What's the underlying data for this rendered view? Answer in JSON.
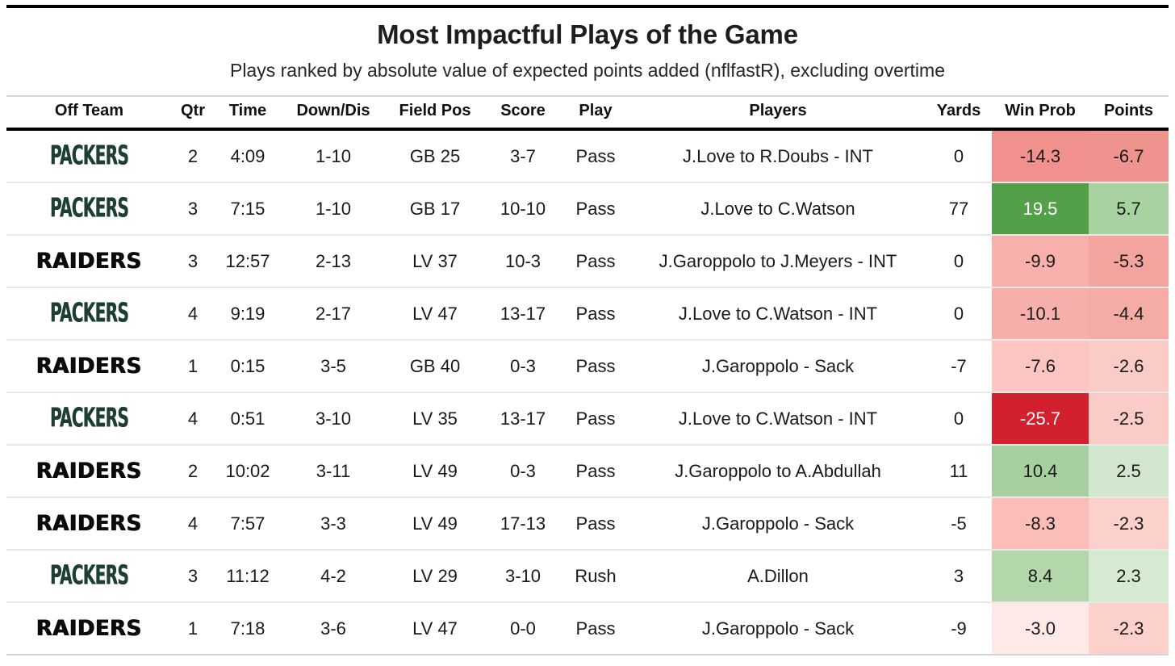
{
  "header": {
    "title": "Most Impactful Plays of the Game",
    "subtitle": "Plays ranked by absolute value of expected points added (nflfastR), excluding overtime"
  },
  "table": {
    "columns": [
      {
        "key": "team",
        "label": "Off Team"
      },
      {
        "key": "qtr",
        "label": "Qtr"
      },
      {
        "key": "time",
        "label": "Time"
      },
      {
        "key": "down",
        "label": "Down/Dis"
      },
      {
        "key": "field",
        "label": "Field Pos"
      },
      {
        "key": "score",
        "label": "Score"
      },
      {
        "key": "play",
        "label": "Play"
      },
      {
        "key": "players",
        "label": "Players"
      },
      {
        "key": "yards",
        "label": "Yards"
      },
      {
        "key": "winprob",
        "label": "Win Prob"
      },
      {
        "key": "points",
        "label": "Points"
      }
    ],
    "rows": [
      {
        "team": "PACKERS",
        "team_class": "packers",
        "qtr": "2",
        "time": "4:09",
        "down": "1-10",
        "field": "GB 25",
        "score": "3-7",
        "play": "Pass",
        "players": "J.Love to R.Doubs - INT",
        "yards": "0",
        "winprob": "-14.3",
        "winprob_bg": "#f0918d",
        "winprob_fg": "#1a1a1a",
        "points": "-6.7",
        "points_bg": "#ef938f",
        "points_fg": "#1a1a1a"
      },
      {
        "team": "PACKERS",
        "team_class": "packers",
        "qtr": "3",
        "time": "7:15",
        "down": "1-10",
        "field": "GB 17",
        "score": "10-10",
        "play": "Pass",
        "players": "J.Love to C.Watson",
        "yards": "77",
        "winprob": "19.5",
        "winprob_bg": "#54a04a",
        "winprob_fg": "#ffffff",
        "points": "5.7",
        "points_bg": "#a8d2a0",
        "points_fg": "#1a1a1a"
      },
      {
        "team": "RAIDERS",
        "team_class": "raiders",
        "qtr": "3",
        "time": "12:57",
        "down": "2-13",
        "field": "LV 37",
        "score": "10-3",
        "play": "Pass",
        "players": "J.Garoppolo to J.Meyers - INT",
        "yards": "0",
        "winprob": "-9.9",
        "winprob_bg": "#f7b0ac",
        "winprob_fg": "#1a1a1a",
        "points": "-5.3",
        "points_bg": "#f3a49f",
        "points_fg": "#1a1a1a"
      },
      {
        "team": "PACKERS",
        "team_class": "packers",
        "qtr": "4",
        "time": "9:19",
        "down": "2-17",
        "field": "LV 47",
        "score": "13-17",
        "play": "Pass",
        "players": "J.Love to C.Watson - INT",
        "yards": "0",
        "winprob": "-10.1",
        "winprob_bg": "#f7afab",
        "winprob_fg": "#1a1a1a",
        "points": "-4.4",
        "points_bg": "#f5aba6",
        "points_fg": "#1a1a1a"
      },
      {
        "team": "RAIDERS",
        "team_class": "raiders",
        "qtr": "1",
        "time": "0:15",
        "down": "3-5",
        "field": "GB 40",
        "score": "0-3",
        "play": "Pass",
        "players": "J.Garoppolo - Sack",
        "yards": "-7",
        "winprob": "-7.6",
        "winprob_bg": "#fbc6c2",
        "winprob_fg": "#1a1a1a",
        "points": "-2.6",
        "points_bg": "#fbcbc6",
        "points_fg": "#1a1a1a"
      },
      {
        "team": "PACKERS",
        "team_class": "packers",
        "qtr": "4",
        "time": "0:51",
        "down": "3-10",
        "field": "LV 35",
        "score": "13-17",
        "play": "Pass",
        "players": "J.Love to C.Watson - INT",
        "yards": "0",
        "winprob": "-25.7",
        "winprob_bg": "#d2202f",
        "winprob_fg": "#ffffff",
        "points": "-2.5",
        "points_bg": "#fbccc7",
        "points_fg": "#1a1a1a"
      },
      {
        "team": "RAIDERS",
        "team_class": "raiders",
        "qtr": "2",
        "time": "10:02",
        "down": "3-11",
        "field": "LV 49",
        "score": "0-3",
        "play": "Pass",
        "players": "J.Garoppolo to A.Abdullah",
        "yards": "11",
        "winprob": "10.4",
        "winprob_bg": "#a7cfa0",
        "winprob_fg": "#1a1a1a",
        "points": "2.5",
        "points_bg": "#d3e7ce",
        "points_fg": "#1a1a1a"
      },
      {
        "team": "RAIDERS",
        "team_class": "raiders",
        "qtr": "4",
        "time": "7:57",
        "down": "3-3",
        "field": "LV 49",
        "score": "17-13",
        "play": "Pass",
        "players": "J.Garoppolo - Sack",
        "yards": "-5",
        "winprob": "-8.3",
        "winprob_bg": "#fabdb8",
        "winprob_fg": "#1a1a1a",
        "points": "-2.3",
        "points_bg": "#fcd0cb",
        "points_fg": "#1a1a1a"
      },
      {
        "team": "PACKERS",
        "team_class": "packers",
        "qtr": "3",
        "time": "11:12",
        "down": "4-2",
        "field": "LV 29",
        "score": "3-10",
        "play": "Rush",
        "players": "A.Dillon",
        "yards": "3",
        "winprob": "8.4",
        "winprob_bg": "#b3d6ab",
        "winprob_fg": "#1a1a1a",
        "points": "2.3",
        "points_bg": "#d6e9d1",
        "points_fg": "#1a1a1a"
      },
      {
        "team": "RAIDERS",
        "team_class": "raiders",
        "qtr": "1",
        "time": "7:18",
        "down": "3-6",
        "field": "LV 47",
        "score": "0-0",
        "play": "Pass",
        "players": "J.Garoppolo - Sack",
        "yards": "-9",
        "winprob": "-3.0",
        "winprob_bg": "#fde9e6",
        "winprob_fg": "#1a1a1a",
        "points": "-2.3",
        "points_bg": "#fcd0cb",
        "points_fg": "#1a1a1a"
      }
    ]
  },
  "colors": {
    "positive_max": "#54a04a",
    "negative_max": "#d2202f",
    "packers_green": "#1d3f31",
    "raiders_black": "#0b0b0b"
  }
}
